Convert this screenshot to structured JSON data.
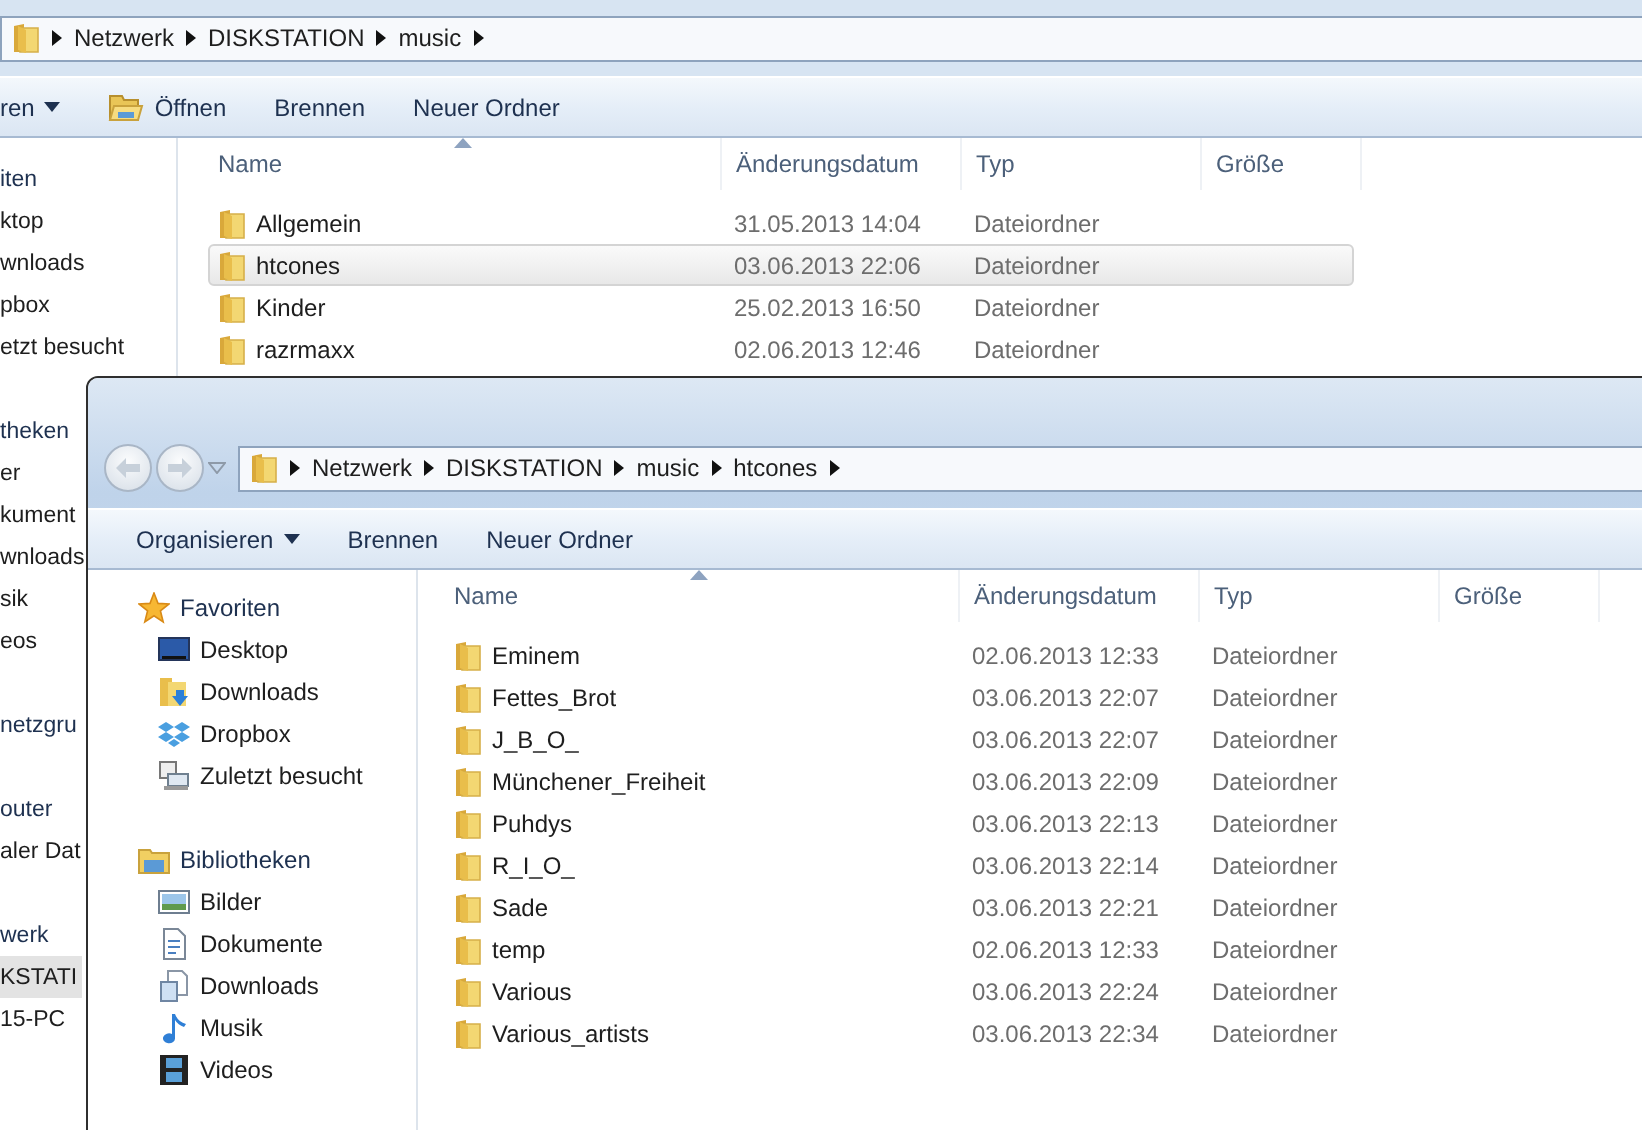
{
  "back_window": {
    "address_bar": {
      "crumbs": [
        "Netzwerk",
        "DISKSTATION",
        "music"
      ]
    },
    "toolbar": [
      {
        "label": "ren",
        "kind": "menu"
      },
      {
        "label": "Öffnen",
        "kind": "open"
      },
      {
        "label": "Brennen",
        "kind": "plain"
      },
      {
        "label": "Neuer Ordner",
        "kind": "plain"
      }
    ],
    "nav_pane": [
      {
        "label": "iten",
        "items": [
          {
            "label": "ktop",
            "selected": false
          },
          {
            "label": "wnloads",
            "selected": false
          },
          {
            "label": "pbox",
            "selected": false
          },
          {
            "label": "etzt besucht",
            "selected": false
          }
        ]
      },
      {
        "label": "theken",
        "items": [
          {
            "label": "er",
            "selected": false
          },
          {
            "label": "kument",
            "selected": false
          },
          {
            "label": "wnloads",
            "selected": false
          },
          {
            "label": "sik",
            "selected": false
          },
          {
            "label": "eos",
            "selected": false
          }
        ]
      },
      {
        "label": "netzgru"
      },
      {
        "label": "outer",
        "items": [
          {
            "label": "aler Dat",
            "selected": false
          }
        ]
      },
      {
        "label": "werk",
        "items": [
          {
            "label": "KSTATI",
            "selected": true
          },
          {
            "label": "15-PC",
            "selected": false
          }
        ]
      }
    ],
    "columns": [
      {
        "label": "Name",
        "sorted": true
      },
      {
        "label": "Änderungsdatum",
        "sorted": false
      },
      {
        "label": "Typ",
        "sorted": false
      },
      {
        "label": "Größe",
        "sorted": false
      }
    ],
    "rows": [
      {
        "name": "Allgemein",
        "modified": "31.05.2013 14:04",
        "type": "Dateiordner",
        "selected": false
      },
      {
        "name": "htcones",
        "modified": "03.06.2013 22:06",
        "type": "Dateiordner",
        "selected": true
      },
      {
        "name": "Kinder",
        "modified": "25.02.2013 16:50",
        "type": "Dateiordner",
        "selected": false
      },
      {
        "name": "razrmaxx",
        "modified": "02.06.2013 12:46",
        "type": "Dateiordner",
        "selected": false
      }
    ]
  },
  "front_window": {
    "address_bar": {
      "crumbs": [
        "Netzwerk",
        "DISKSTATION",
        "music",
        "htcones"
      ]
    },
    "toolbar": [
      {
        "label": "Organisieren",
        "kind": "menu"
      },
      {
        "label": "Brennen",
        "kind": "plain"
      },
      {
        "label": "Neuer Ordner",
        "kind": "plain"
      }
    ],
    "nav_pane": [
      {
        "label": "Favoriten",
        "kind": "favorites",
        "items": [
          {
            "label": "Desktop",
            "kind": "desktop",
            "selected": false
          },
          {
            "label": "Downloads",
            "kind": "downloads",
            "selected": false
          },
          {
            "label": "Dropbox",
            "kind": "dropbox",
            "selected": false
          },
          {
            "label": "Zuletzt besucht",
            "kind": "recent",
            "selected": false
          }
        ]
      },
      {
        "label": "Bibliotheken",
        "kind": "libraries",
        "items": [
          {
            "label": "Bilder",
            "kind": "pictures",
            "selected": false
          },
          {
            "label": "Dokumente",
            "kind": "documents",
            "selected": false
          },
          {
            "label": "Downloads",
            "kind": "libdownloads",
            "selected": false
          },
          {
            "label": "Musik",
            "kind": "music",
            "selected": false
          },
          {
            "label": "Videos",
            "kind": "videos",
            "selected": false
          }
        ]
      }
    ],
    "columns": [
      {
        "label": "Name",
        "sorted": true
      },
      {
        "label": "Änderungsdatum",
        "sorted": false
      },
      {
        "label": "Typ",
        "sorted": false
      },
      {
        "label": "Größe",
        "sorted": false
      }
    ],
    "rows": [
      {
        "name": "Eminem",
        "modified": "02.06.2013 12:33",
        "type": "Dateiordner",
        "selected": false
      },
      {
        "name": "Fettes_Brot",
        "modified": "03.06.2013 22:07",
        "type": "Dateiordner",
        "selected": false
      },
      {
        "name": "J_B_O_",
        "modified": "03.06.2013 22:07",
        "type": "Dateiordner",
        "selected": false
      },
      {
        "name": "Münchener_Freiheit",
        "modified": "03.06.2013 22:09",
        "type": "Dateiordner",
        "selected": false
      },
      {
        "name": "Puhdys",
        "modified": "03.06.2013 22:13",
        "type": "Dateiordner",
        "selected": false
      },
      {
        "name": "R_I_O_",
        "modified": "03.06.2013 22:14",
        "type": "Dateiordner",
        "selected": false
      },
      {
        "name": "Sade",
        "modified": "03.06.2013 22:21",
        "type": "Dateiordner",
        "selected": false
      },
      {
        "name": "temp",
        "modified": "02.06.2013 12:33",
        "type": "Dateiordner",
        "selected": false
      },
      {
        "name": "Various",
        "modified": "03.06.2013 22:24",
        "type": "Dateiordner",
        "selected": false
      },
      {
        "name": "Various_artists",
        "modified": "03.06.2013 22:34",
        "type": "Dateiordner",
        "selected": false
      }
    ]
  }
}
